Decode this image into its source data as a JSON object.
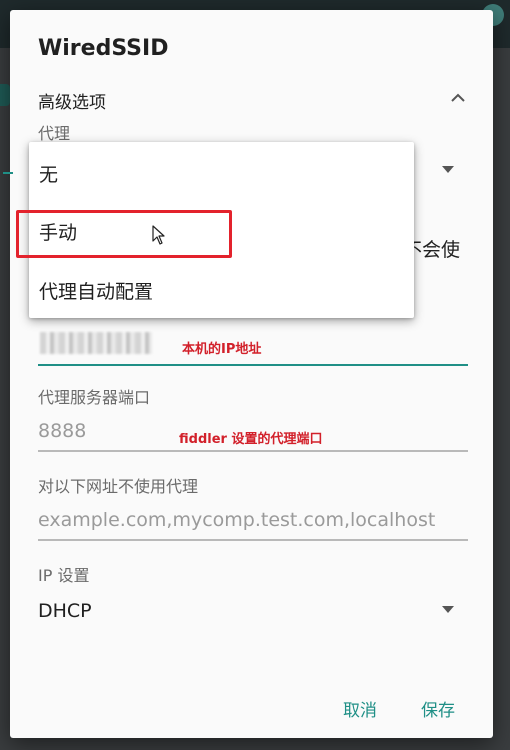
{
  "dialog": {
    "title": "WiredSSID",
    "advanced_label": "高级选项",
    "proxy_label": "代理",
    "partial_text": "不会使",
    "proxy_port_label": "代理服务器端口",
    "proxy_port_placeholder": "8888",
    "bypass_label": "对以下网址不使用代理",
    "bypass_placeholder": "example.com,mycomp.test.com,localhost",
    "ip_settings_label": "IP 设置",
    "ip_settings_value": "DHCP",
    "cancel_label": "取消",
    "save_label": "保存"
  },
  "proxy_menu": {
    "options": [
      "无",
      "手动",
      "代理自动配置"
    ]
  },
  "annotations": {
    "ip_note": "本机的IP地址",
    "port_note": "fiddler 设置的代理端口"
  },
  "colors": {
    "accent": "#1f8f86",
    "annotation": "#d2202a"
  }
}
